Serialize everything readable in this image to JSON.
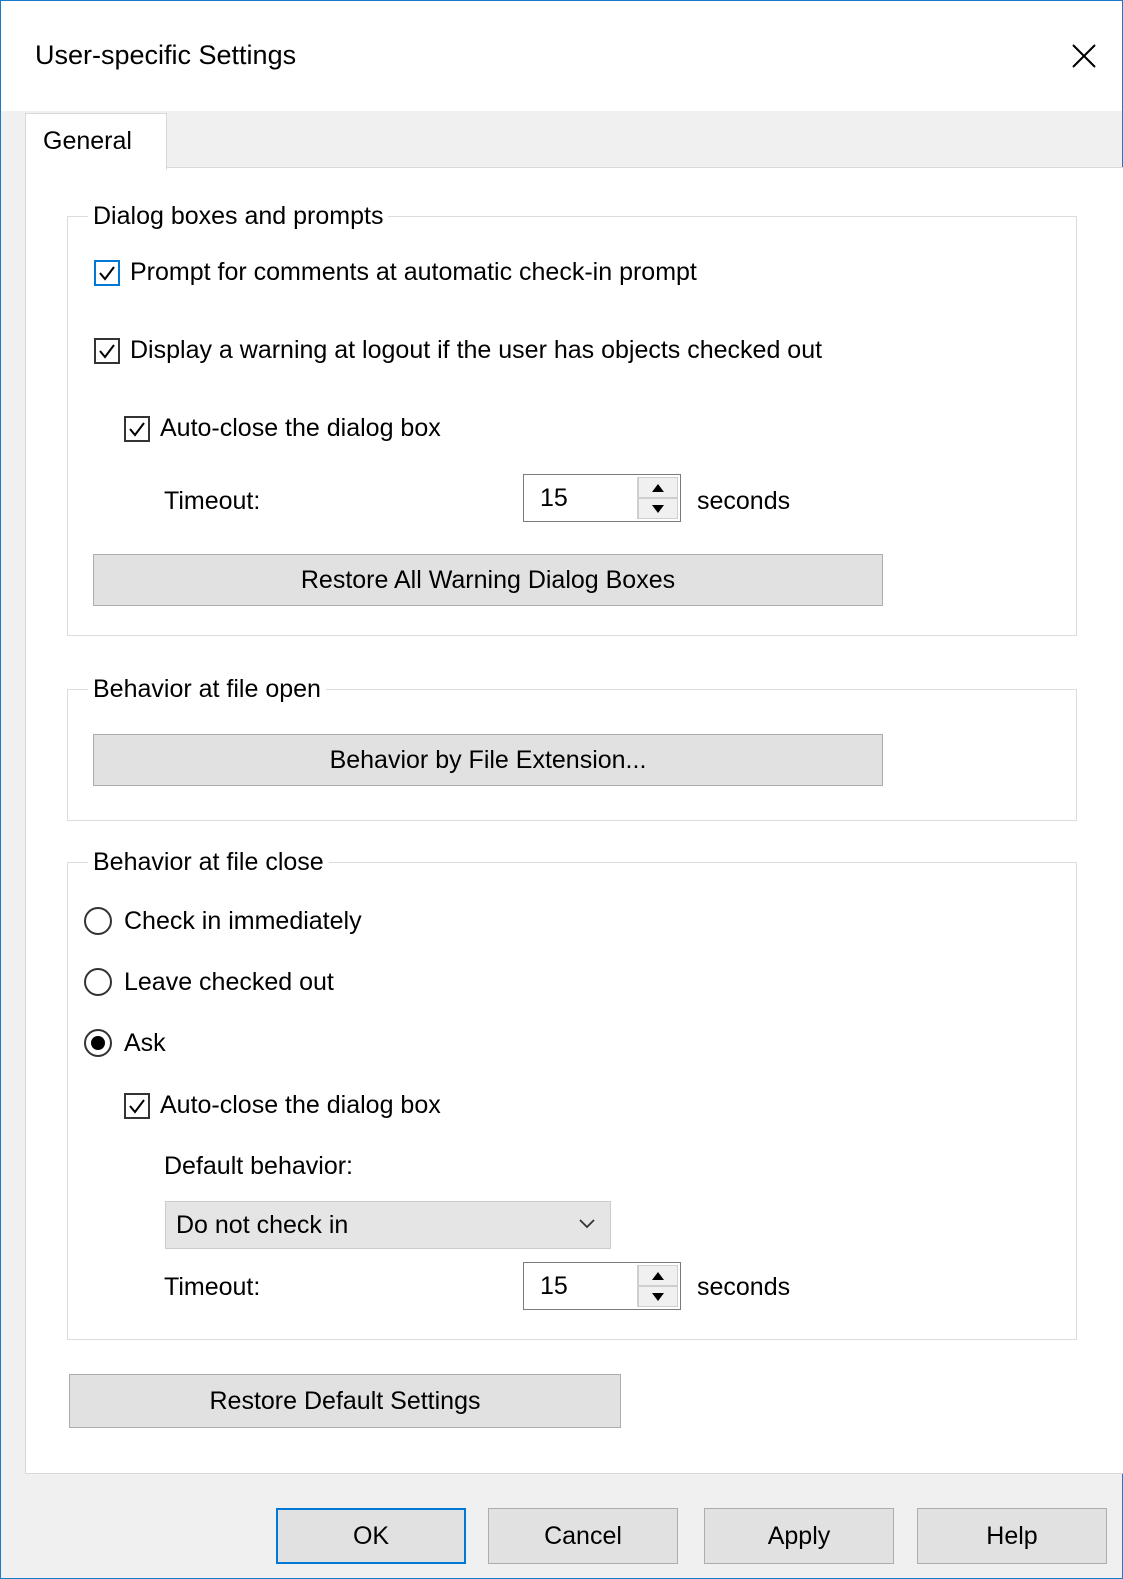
{
  "window": {
    "title": "User-specific Settings"
  },
  "tabs": [
    {
      "label": "General",
      "selected": true
    }
  ],
  "dialogs_group": {
    "legend": "Dialog boxes and prompts",
    "prompt_comments": {
      "label": "Prompt for comments at automatic check-in prompt",
      "checked": true
    },
    "warning_logout": {
      "label": "Display a warning at logout if the user has objects checked out",
      "checked": true
    },
    "auto_close": {
      "label": "Auto-close the dialog box",
      "checked": true
    },
    "timeout": {
      "label": "Timeout:",
      "value": "15",
      "unit": "seconds"
    },
    "restore_warnings_button": "Restore All Warning Dialog Boxes"
  },
  "open_group": {
    "legend": "Behavior at file open",
    "extension_button": "Behavior by File Extension..."
  },
  "close_group": {
    "legend": "Behavior at file close",
    "radios": [
      {
        "label": "Check in immediately",
        "selected": false
      },
      {
        "label": "Leave checked out",
        "selected": false
      },
      {
        "label": "Ask",
        "selected": true
      }
    ],
    "auto_close": {
      "label": "Auto-close the dialog box",
      "checked": true
    },
    "default_behavior": {
      "label": "Default behavior:",
      "value": "Do not check in"
    },
    "timeout": {
      "label": "Timeout:",
      "value": "15",
      "unit": "seconds"
    }
  },
  "restore_defaults_button": "Restore Default Settings",
  "footer": {
    "ok": "OK",
    "cancel": "Cancel",
    "apply": "Apply",
    "help": "Help"
  },
  "colors": {
    "accent": "#0078d7",
    "dialog_border": "#1979ca",
    "background": "#f0f0f0",
    "button": "#e1e1e1"
  }
}
